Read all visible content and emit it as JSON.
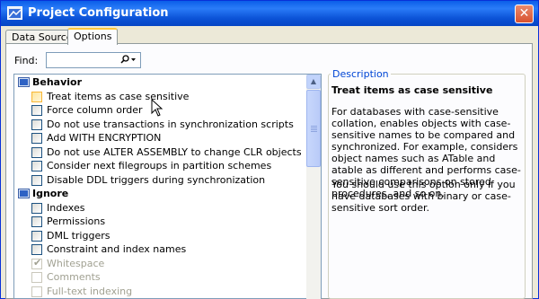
{
  "window": {
    "title": "Project Configuration",
    "close_glyph": "✕"
  },
  "tabs": [
    {
      "label": "Data Sources",
      "active": false
    },
    {
      "label": "Options",
      "active": true
    }
  ],
  "find": {
    "label": "Find:",
    "value": "",
    "icon": "search-icon"
  },
  "groups": [
    {
      "label": "Behavior",
      "icon": "group-folder-icon",
      "items": [
        {
          "label": "Treat items as case sensitive",
          "checked": false,
          "highlighted": true,
          "disabled": false
        },
        {
          "label": "Force column order",
          "checked": false,
          "highlighted": false,
          "disabled": false
        },
        {
          "label": "Do not use transactions in synchronization scripts",
          "checked": false,
          "highlighted": false,
          "disabled": false
        },
        {
          "label": "Add WITH ENCRYPTION",
          "checked": false,
          "highlighted": false,
          "disabled": false
        },
        {
          "label": "Do not use ALTER ASSEMBLY to change CLR objects",
          "checked": false,
          "highlighted": false,
          "disabled": false
        },
        {
          "label": "Consider next filegroups in partition schemes",
          "checked": false,
          "highlighted": false,
          "disabled": false
        },
        {
          "label": "Disable DDL triggers during synchronization",
          "checked": false,
          "highlighted": false,
          "disabled": false
        }
      ]
    },
    {
      "label": "Ignore",
      "icon": "group-folder-icon",
      "items": [
        {
          "label": "Indexes",
          "checked": false,
          "highlighted": false,
          "disabled": false
        },
        {
          "label": "Permissions",
          "checked": false,
          "highlighted": false,
          "disabled": false
        },
        {
          "label": "DML triggers",
          "checked": false,
          "highlighted": false,
          "disabled": false
        },
        {
          "label": "Constraint and index names",
          "checked": false,
          "highlighted": false,
          "disabled": false
        },
        {
          "label": "Whitespace",
          "checked": true,
          "highlighted": false,
          "disabled": true
        },
        {
          "label": "Comments",
          "checked": false,
          "highlighted": false,
          "disabled": true
        },
        {
          "label": "Full-text indexing",
          "checked": false,
          "highlighted": false,
          "disabled": true
        }
      ]
    }
  ],
  "description": {
    "legend": "Description",
    "title": "Treat items as case sensitive",
    "paragraphs": [
      "For databases with case-sensitive collation, enables objects with case-sensitive names to be compared and synchronized. For example, considers object names such as ATable and atable as different and performs case-sensitive comparisons on stored procedures, and so on.",
      "You should use this option only if you have databases with binary or case-sensitive sort order."
    ]
  },
  "colors": {
    "titlebar": "#0b52d6",
    "accent_tab": "#ffc83c",
    "legend": "#0046d5"
  }
}
